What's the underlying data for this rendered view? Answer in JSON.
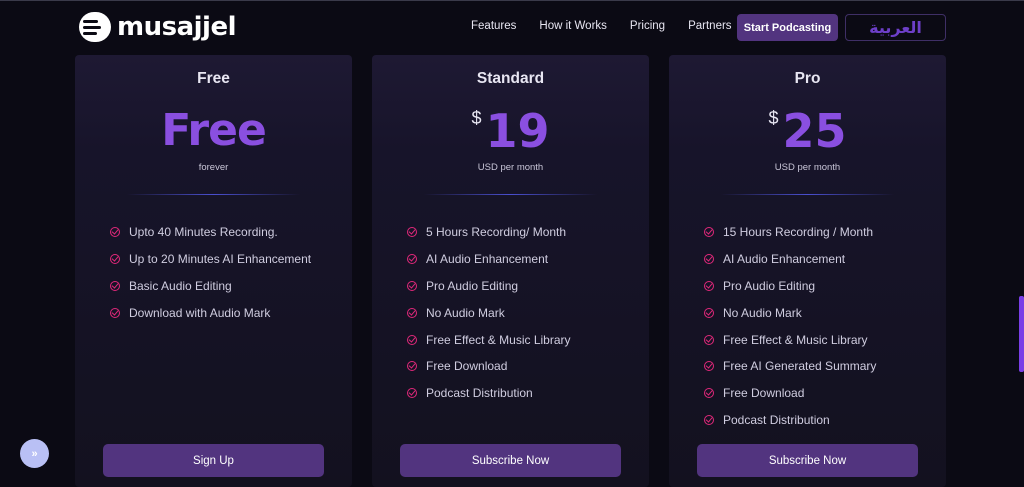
{
  "header": {
    "brand": "musajjel",
    "nav": [
      {
        "label": "Features"
      },
      {
        "label": "How it Works"
      },
      {
        "label": "Pricing"
      },
      {
        "label": "Partners"
      }
    ],
    "cta_label": "Start Podcasting",
    "language_label": "العربية"
  },
  "plans": [
    {
      "name": "Free",
      "price_text": "Free",
      "period": "forever",
      "features": [
        "Upto 40 Minutes Recording.",
        "Up to 20 Minutes AI Enhancement",
        "Basic Audio Editing",
        "Download with Audio Mark"
      ],
      "button_label": "Sign Up"
    },
    {
      "name": "Standard",
      "currency": "$",
      "price": "19",
      "period": "USD per month",
      "features": [
        "5 Hours Recording/ Month",
        "AI Audio Enhancement",
        "Pro Audio Editing",
        "No Audio Mark",
        "Free Effect & Music Library",
        "Free Download",
        "Podcast Distribution"
      ],
      "button_label": "Subscribe Now"
    },
    {
      "name": "Pro",
      "currency": "$",
      "price": "25",
      "period": "USD per month",
      "features": [
        "15 Hours Recording / Month",
        "AI Audio Enhancement",
        "Pro Audio Editing",
        "No Audio Mark",
        "Free Effect & Music Library",
        "Free AI Generated Summary",
        "Free Download",
        "Podcast Distribution"
      ],
      "button_label": "Subscribe Now"
    }
  ],
  "floating_button_label": "»",
  "colors": {
    "background": "#0b0a14",
    "accent": "#8a4fe0",
    "button": "#52347f",
    "check": "#e0287a"
  }
}
